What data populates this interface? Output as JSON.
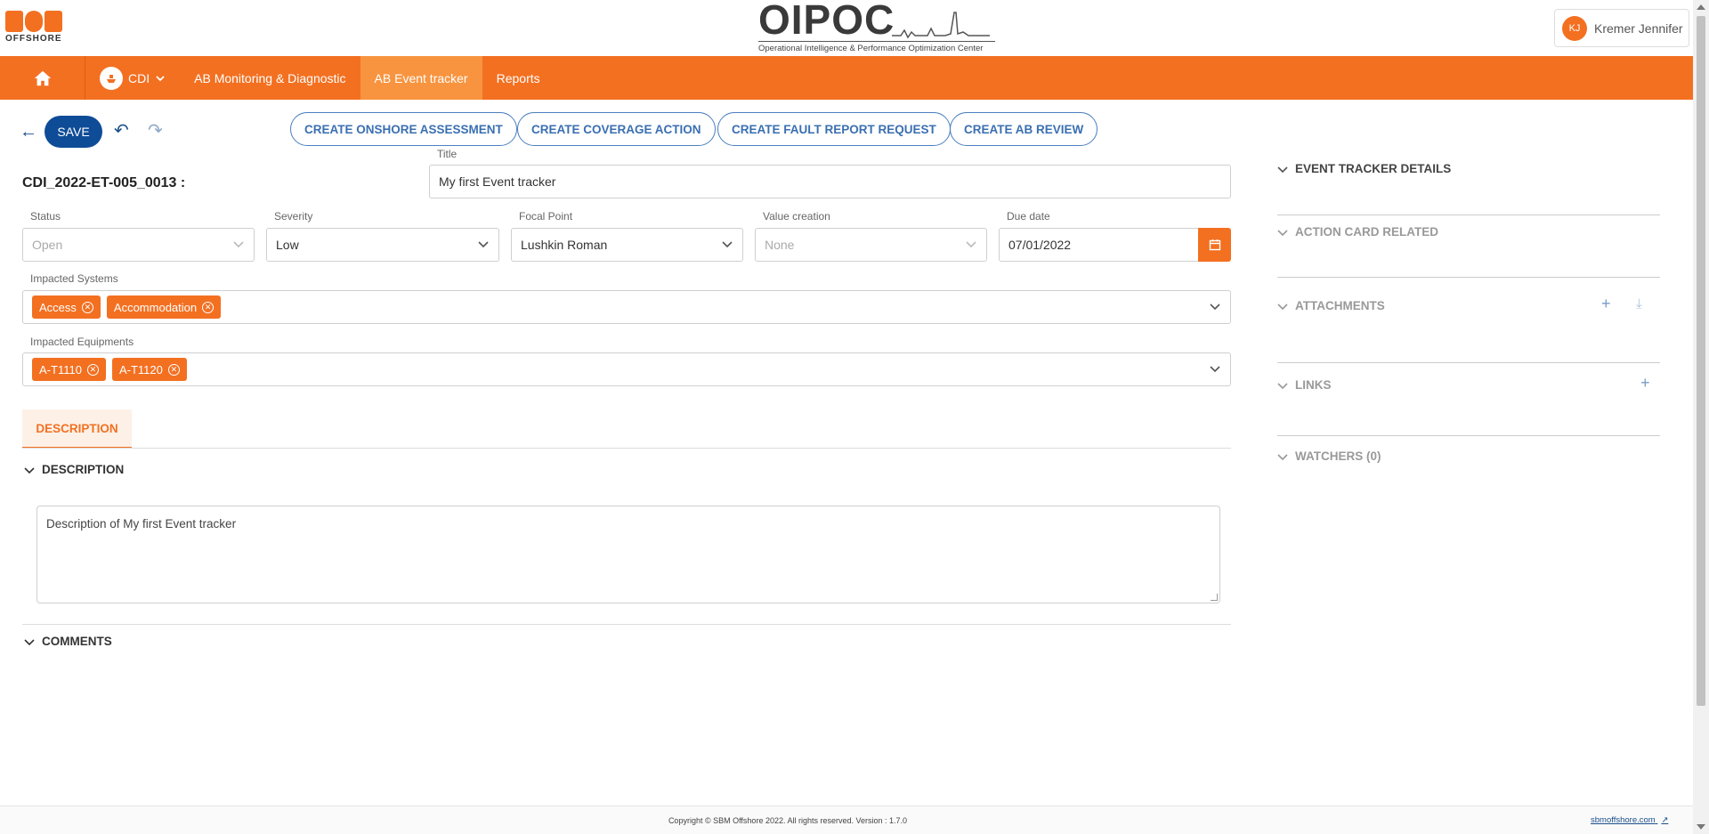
{
  "header": {
    "sbm_logo_text": "OFFSHORE",
    "oipoc_title": "OIPOC",
    "oipoc_subtitle": "Operational Intelligence & Performance Optimization Center",
    "user_initials": "KJ",
    "user_name": "Kremer Jennifer"
  },
  "nav": {
    "home_icon": "home-icon",
    "site": "CDI",
    "items": [
      "AB Monitoring & Diagnostic",
      "AB Event tracker",
      "Reports"
    ],
    "active_index": 1
  },
  "toolbar": {
    "save_label": "SAVE",
    "actions": [
      "CREATE ONSHORE ASSESSMENT",
      "CREATE COVERAGE ACTION",
      "CREATE FAULT REPORT REQUEST",
      "CREATE AB REVIEW"
    ]
  },
  "form": {
    "record_id": "CDI_2022-ET-005_0013 :",
    "title_label": "Title",
    "title_value": "My first Event tracker",
    "status_label": "Status",
    "status_value": "Open",
    "severity_label": "Severity",
    "severity_value": "Low",
    "focal_label": "Focal Point",
    "focal_value": "Lushkin Roman",
    "value_label": "Value creation",
    "value_value": "None",
    "due_label": "Due date",
    "due_value": "07/01/2022",
    "systems_label": "Impacted Systems",
    "systems": [
      "Access",
      "Accommodation"
    ],
    "equipments_label": "Impacted Equipments",
    "equipments": [
      "A-T1110",
      "A-T1120"
    ]
  },
  "tabs": {
    "description_tab": "DESCRIPTION"
  },
  "sections": {
    "description_head": "DESCRIPTION",
    "description_text": "Description of My first Event tracker",
    "comments_head": "COMMENTS"
  },
  "right_panel": {
    "details": "EVENT TRACKER DETAILS",
    "action_card": "ACTION CARD RELATED",
    "attachments": "ATTACHMENTS",
    "links": "LINKS",
    "watchers": "WATCHERS (0)"
  },
  "footer": {
    "copyright": "Copyright © SBM Offshore 2022. All rights reserved.   Version : 1.7.0",
    "link": "sbmoffshore.com"
  },
  "colors": {
    "brand_orange": "#f37021",
    "active_nav": "#f8943f",
    "primary_blue": "#0f4c97"
  }
}
